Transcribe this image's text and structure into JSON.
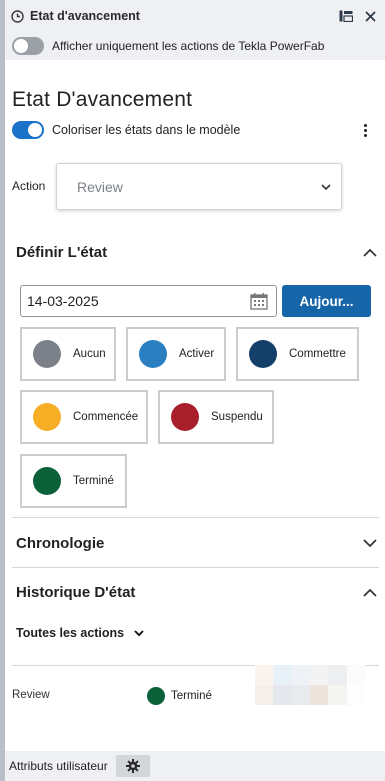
{
  "window": {
    "title": "Etat d'avancement"
  },
  "powerfab_toggle": {
    "label": "Afficher uniquement les actions de Tekla PowerFab",
    "on": false
  },
  "main": {
    "heading": "Etat D'avancement",
    "colorize": {
      "label": "Coloriser les états dans le modèle",
      "on": true
    },
    "action": {
      "label": "Action",
      "selected": "Review"
    }
  },
  "define_state": {
    "title": "Définir L'état",
    "date_value": "14-03-2025",
    "today_button": "Aujour...",
    "states": [
      {
        "label": "Aucun",
        "color": "#7c8089"
      },
      {
        "label": "Activer",
        "color": "#2a7fc1"
      },
      {
        "label": "Commettre",
        "color": "#133f69"
      },
      {
        "label": "Commencée",
        "color": "#f6ae24"
      },
      {
        "label": "Suspendu",
        "color": "#a91e2b"
      },
      {
        "label": "Terminé",
        "color": "#0b6138"
      }
    ]
  },
  "timeline": {
    "title": "Chronologie"
  },
  "history": {
    "title": "Historique D'état",
    "filter_label": "Toutes les actions",
    "rows": [
      {
        "action": "Review",
        "state": "Terminé",
        "state_color": "#0b6138"
      }
    ]
  },
  "footer": {
    "label": "Attributs utilisateur"
  },
  "colors": {
    "accent": "#1565a8",
    "panel_bg": "#eef0f3"
  }
}
